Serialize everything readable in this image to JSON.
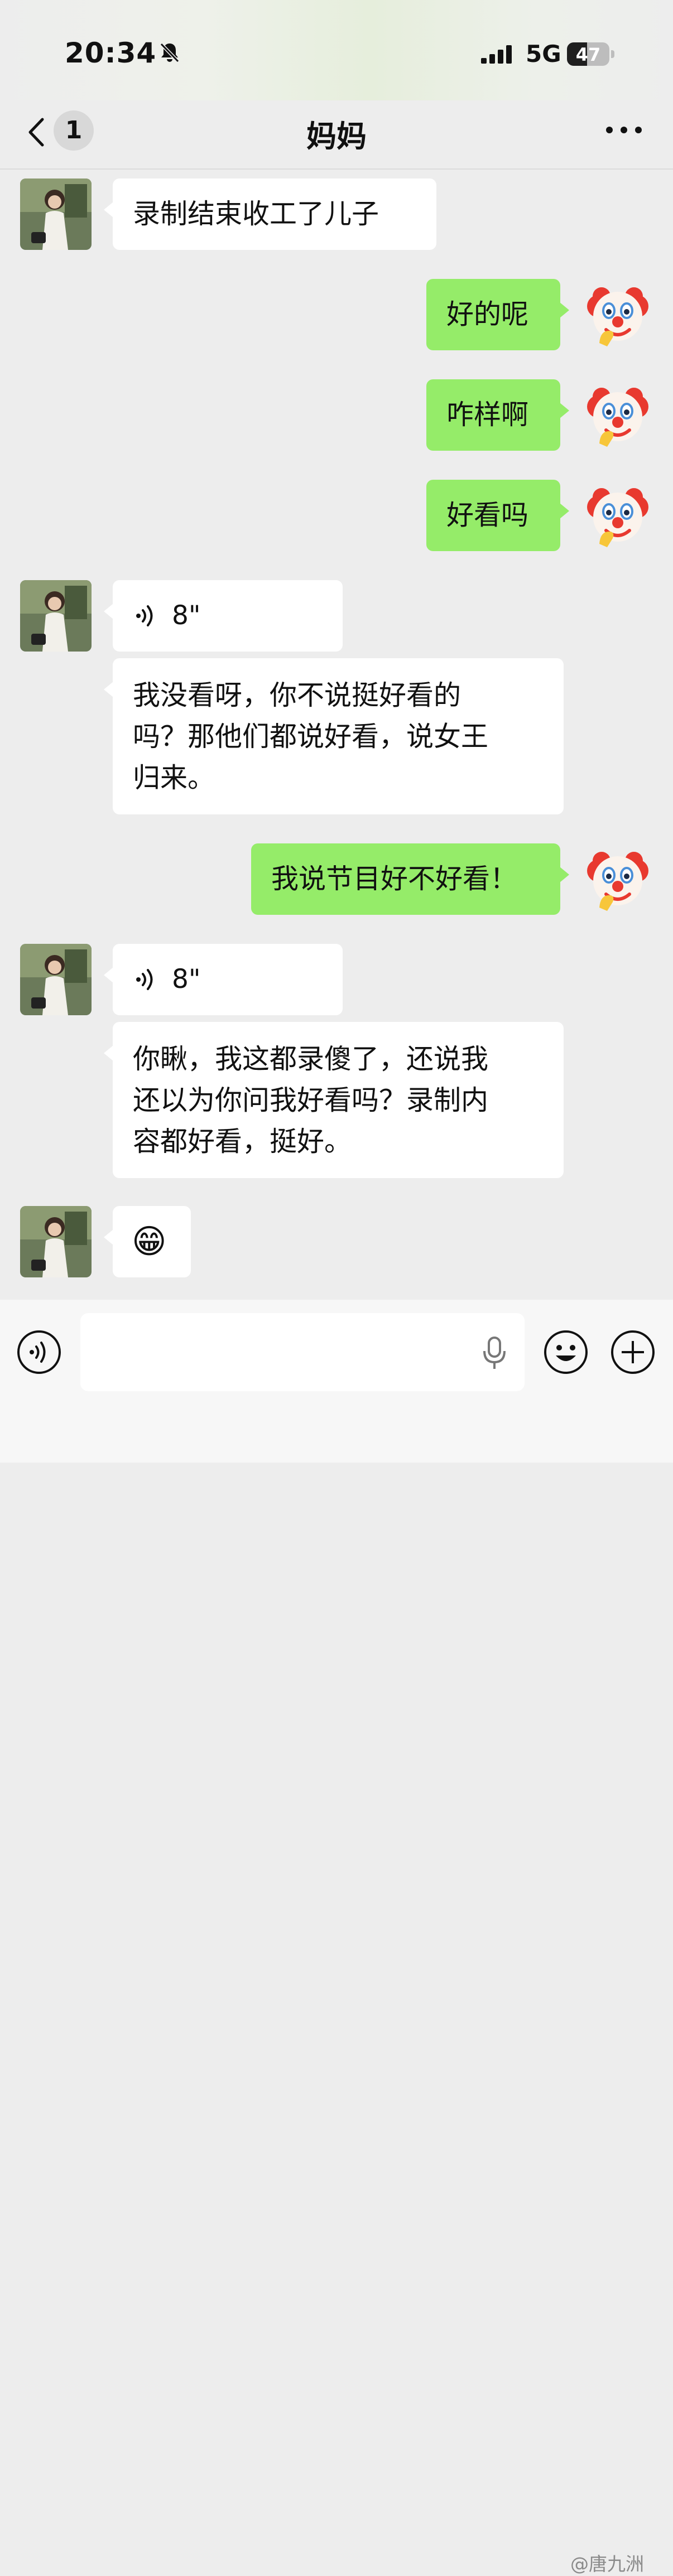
{
  "status_bar": {
    "time": "20:34",
    "network": "5G",
    "battery": "47",
    "battery_level": 0.47
  },
  "nav": {
    "unread_count": "1",
    "title": "妈妈"
  },
  "messages": [
    {
      "side": "in",
      "type": "text",
      "text": "录制结束收工了儿子"
    },
    {
      "side": "out",
      "type": "text",
      "text": "好的呢"
    },
    {
      "side": "out",
      "type": "text",
      "text": "咋样啊"
    },
    {
      "side": "out",
      "type": "text",
      "text": "好看吗"
    },
    {
      "side": "in",
      "type": "voice",
      "duration": "8\""
    },
    {
      "side": "in",
      "type": "text",
      "lines": [
        "我没看呀，你不说挺好看的",
        "吗？那他们都说好看，说女王",
        "归来。"
      ]
    },
    {
      "side": "out",
      "type": "text",
      "text": "我说节目好不好看！"
    },
    {
      "side": "in",
      "type": "voice",
      "duration": "8\""
    },
    {
      "side": "in",
      "type": "text",
      "lines": [
        "你瞅，我这都录傻了，还说我",
        "还以为你问我好看吗？录制内",
        "容都好看，挺好。"
      ]
    },
    {
      "side": "in",
      "type": "emoji",
      "text": "😁"
    }
  ],
  "input_bar": {
    "placeholder": ""
  },
  "watermark": "@唐九洲",
  "icons": [
    "bell-muted-icon",
    "signal-icon",
    "battery-icon",
    "back-icon",
    "more-icon",
    "voice-icon",
    "mic-icon",
    "emoji-icon",
    "plus-icon",
    "clown-avatar-icon"
  ],
  "colors": {
    "background": "#ededed",
    "outgoing_bubble": "#95ec69",
    "incoming_bubble": "#ffffff"
  }
}
